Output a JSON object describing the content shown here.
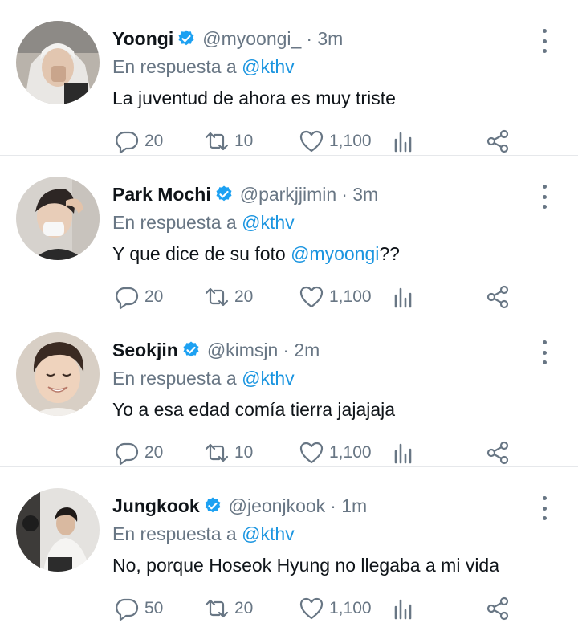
{
  "colors": {
    "link": "#1b95e0",
    "muted": "#687684",
    "verified": "#1da1f2"
  },
  "icons": {
    "reply": "reply-icon",
    "retweet": "retweet-icon",
    "like": "heart-icon",
    "stats": "analytics-icon",
    "share": "share-icon",
    "more": "more-vertical-icon",
    "verified": "verified-badge-icon"
  },
  "tweets": [
    {
      "name": "Yoongi",
      "handle": "@myoongi_",
      "time": "· 3m",
      "reply_prefix": "En respuesta a",
      "reply_to": "@kthv",
      "text_before": "La juventud de ahora es muy triste",
      "text_mention": "",
      "text_after": "",
      "replies": "20",
      "retweets": "10",
      "likes": "1,100"
    },
    {
      "name": "Park Mochi",
      "handle": "@parkjjimin",
      "time": "· 3m",
      "reply_prefix": "En respuesta a",
      "reply_to": "@kthv",
      "text_before": "Y que dice de su foto ",
      "text_mention": "@myoongi",
      "text_after": "??",
      "replies": "20",
      "retweets": "20",
      "likes": "1,100"
    },
    {
      "name": "Seokjin",
      "handle": "@kimsjn",
      "time": "· 2m",
      "reply_prefix": "En respuesta a",
      "reply_to": "@kthv",
      "text_before": "Yo a esa edad comía tierra jajajaja",
      "text_mention": "",
      "text_after": "",
      "replies": "20",
      "retweets": "10",
      "likes": "1,100"
    },
    {
      "name": "Jungkook",
      "handle": "@jeonjkook",
      "time": "· 1m",
      "reply_prefix": "En respuesta a",
      "reply_to": "@kthv",
      "text_before": "No, porque Hoseok Hyung no llegaba a mi vida",
      "text_mention": "",
      "text_after": "",
      "replies": "50",
      "retweets": "20",
      "likes": "1,100"
    }
  ]
}
